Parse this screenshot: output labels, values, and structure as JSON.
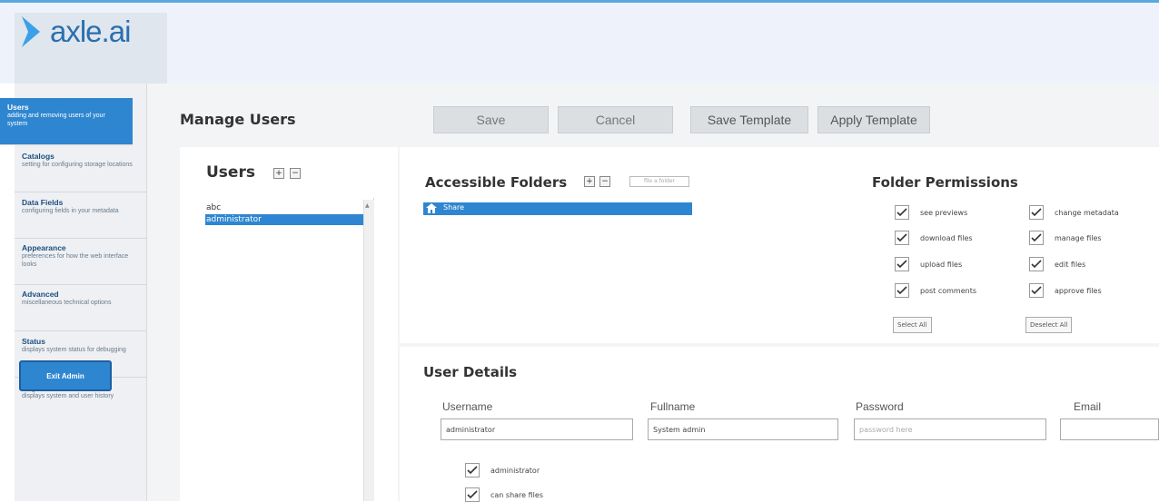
{
  "app": {
    "logo_text": "axle",
    "logo_suffix": ".ai"
  },
  "sidebar": {
    "items": [
      {
        "title": "Users",
        "desc": "adding and removing users of your system",
        "active": true
      },
      {
        "title": "Catalogs",
        "desc": "setting for configuring storage locations"
      },
      {
        "title": "Data Fields",
        "desc": "configuring fields in your metadata"
      },
      {
        "title": "Appearance",
        "desc": "preferences for how the web interface looks"
      },
      {
        "title": "Advanced",
        "desc": "miscellaneous technical options"
      },
      {
        "title": "Status",
        "desc": "displays system status for debugging"
      },
      {
        "title": "Logs",
        "desc": "displays system and user history"
      }
    ],
    "exit_label": "Exit Admin"
  },
  "header": {
    "title": "Manage Users",
    "buttons": {
      "save": "Save",
      "cancel": "Cancel",
      "save_template": "Save Template",
      "apply_template": "Apply Template"
    }
  },
  "users": {
    "heading": "Users",
    "add": "+",
    "remove": "−",
    "list": [
      "abc",
      "administrator"
    ],
    "selected": "administrator"
  },
  "folders": {
    "heading": "Accessible Folders",
    "add": "+",
    "remove": "−",
    "extra_label": "file a folder",
    "root": "Share"
  },
  "permissions": {
    "heading": "Folder Permissions",
    "left": [
      "see previews",
      "download files",
      "upload files",
      "post comments"
    ],
    "right": [
      "change metadata",
      "manage files",
      "edit files",
      "approve files"
    ],
    "select_all": "Select All",
    "deselect_all": "Deselect All"
  },
  "details": {
    "heading": "User Details",
    "username_label": "Username",
    "username_value": "administrator",
    "fullname_label": "Fullname",
    "fullname_value": "System admin",
    "password_label": "Password",
    "password_placeholder": "password here",
    "email_label": "Email",
    "email_value": "",
    "options": [
      "administrator",
      "can share files"
    ]
  },
  "colors": {
    "accent": "#2f86d0",
    "topbar": "#eef3fb"
  }
}
